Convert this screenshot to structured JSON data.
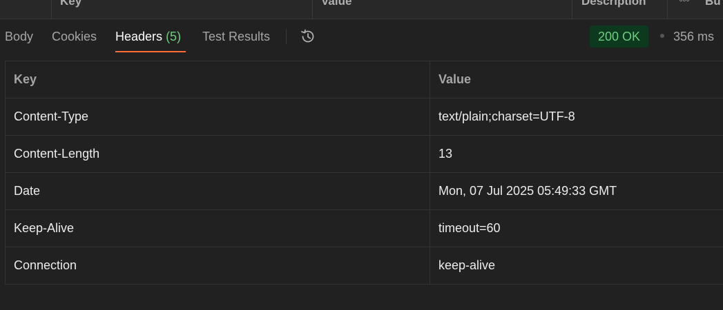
{
  "params_table": {
    "columns": [
      "Key",
      "Value",
      "Description",
      "Bu"
    ]
  },
  "response_tabs": [
    {
      "label": "Body"
    },
    {
      "label": "Cookies"
    },
    {
      "label": "Headers",
      "count": "(5)"
    },
    {
      "label": "Test Results"
    }
  ],
  "status": {
    "code_text": "200 OK",
    "time": "356 ms",
    "color": "#6ccf7e"
  },
  "headers_table": {
    "columns": [
      "Key",
      "Value"
    ],
    "rows": [
      {
        "key": "Content-Type",
        "value": "text/plain;charset=UTF-8"
      },
      {
        "key": "Content-Length",
        "value": "13"
      },
      {
        "key": "Date",
        "value": "Mon, 07 Jul 2025 05:49:33 GMT"
      },
      {
        "key": "Keep-Alive",
        "value": "timeout=60"
      },
      {
        "key": "Connection",
        "value": "keep-alive"
      }
    ]
  },
  "icons": {
    "history": "history-icon",
    "bulk_edit": "more-dots-icon"
  },
  "colors": {
    "accent": "#ff6c37",
    "background": "#212121",
    "status_bg": "#0d3a1f"
  }
}
